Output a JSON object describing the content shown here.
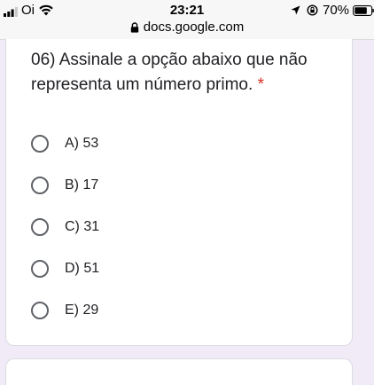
{
  "status_bar": {
    "carrier": "Oi",
    "time": "23:21",
    "battery": "70%",
    "url": "docs.google.com",
    "icons": [
      "signal-icon",
      "wifi-icon",
      "location-arrow-icon",
      "rotation-lock-icon",
      "battery-icon",
      "lock-icon"
    ]
  },
  "question": {
    "title": "06) Assinale a opção abaixo que não representa um número primo.",
    "required_mark": "*",
    "options": [
      "A) 53",
      "B) 17",
      "C) 31",
      "D) 51",
      "E) 29"
    ]
  },
  "colors": {
    "background": "#f0ebf7",
    "required": "#d93025",
    "radio_border": "#5f6368"
  }
}
